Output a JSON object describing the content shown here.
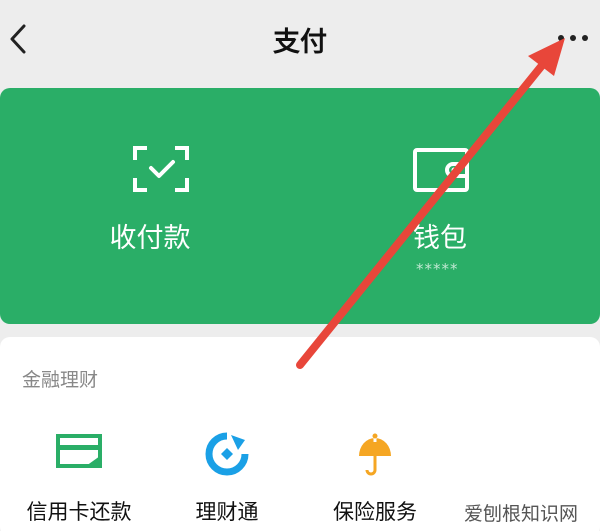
{
  "nav": {
    "title": "支付",
    "back_icon": "chevron-left-icon",
    "more_icon": "more-dots-icon"
  },
  "main_features": [
    {
      "label": "收付款",
      "icon": "scan-check-icon"
    },
    {
      "label": "钱包",
      "sub": "*****",
      "icon": "wallet-icon"
    }
  ],
  "finance": {
    "title": "金融理财",
    "items": [
      {
        "label": "信用卡还款",
        "icon": "credit-card-icon",
        "color": "#2aae67"
      },
      {
        "label": "理财通",
        "icon": "licaitong-icon",
        "color": "#1aa0e6"
      },
      {
        "label": "保险服务",
        "icon": "umbrella-icon",
        "color": "#f5a623"
      }
    ]
  },
  "colors": {
    "brand_green": "#2aae67",
    "annotation_arrow": "#e8463a"
  },
  "watermark": "爱刨根知识网"
}
